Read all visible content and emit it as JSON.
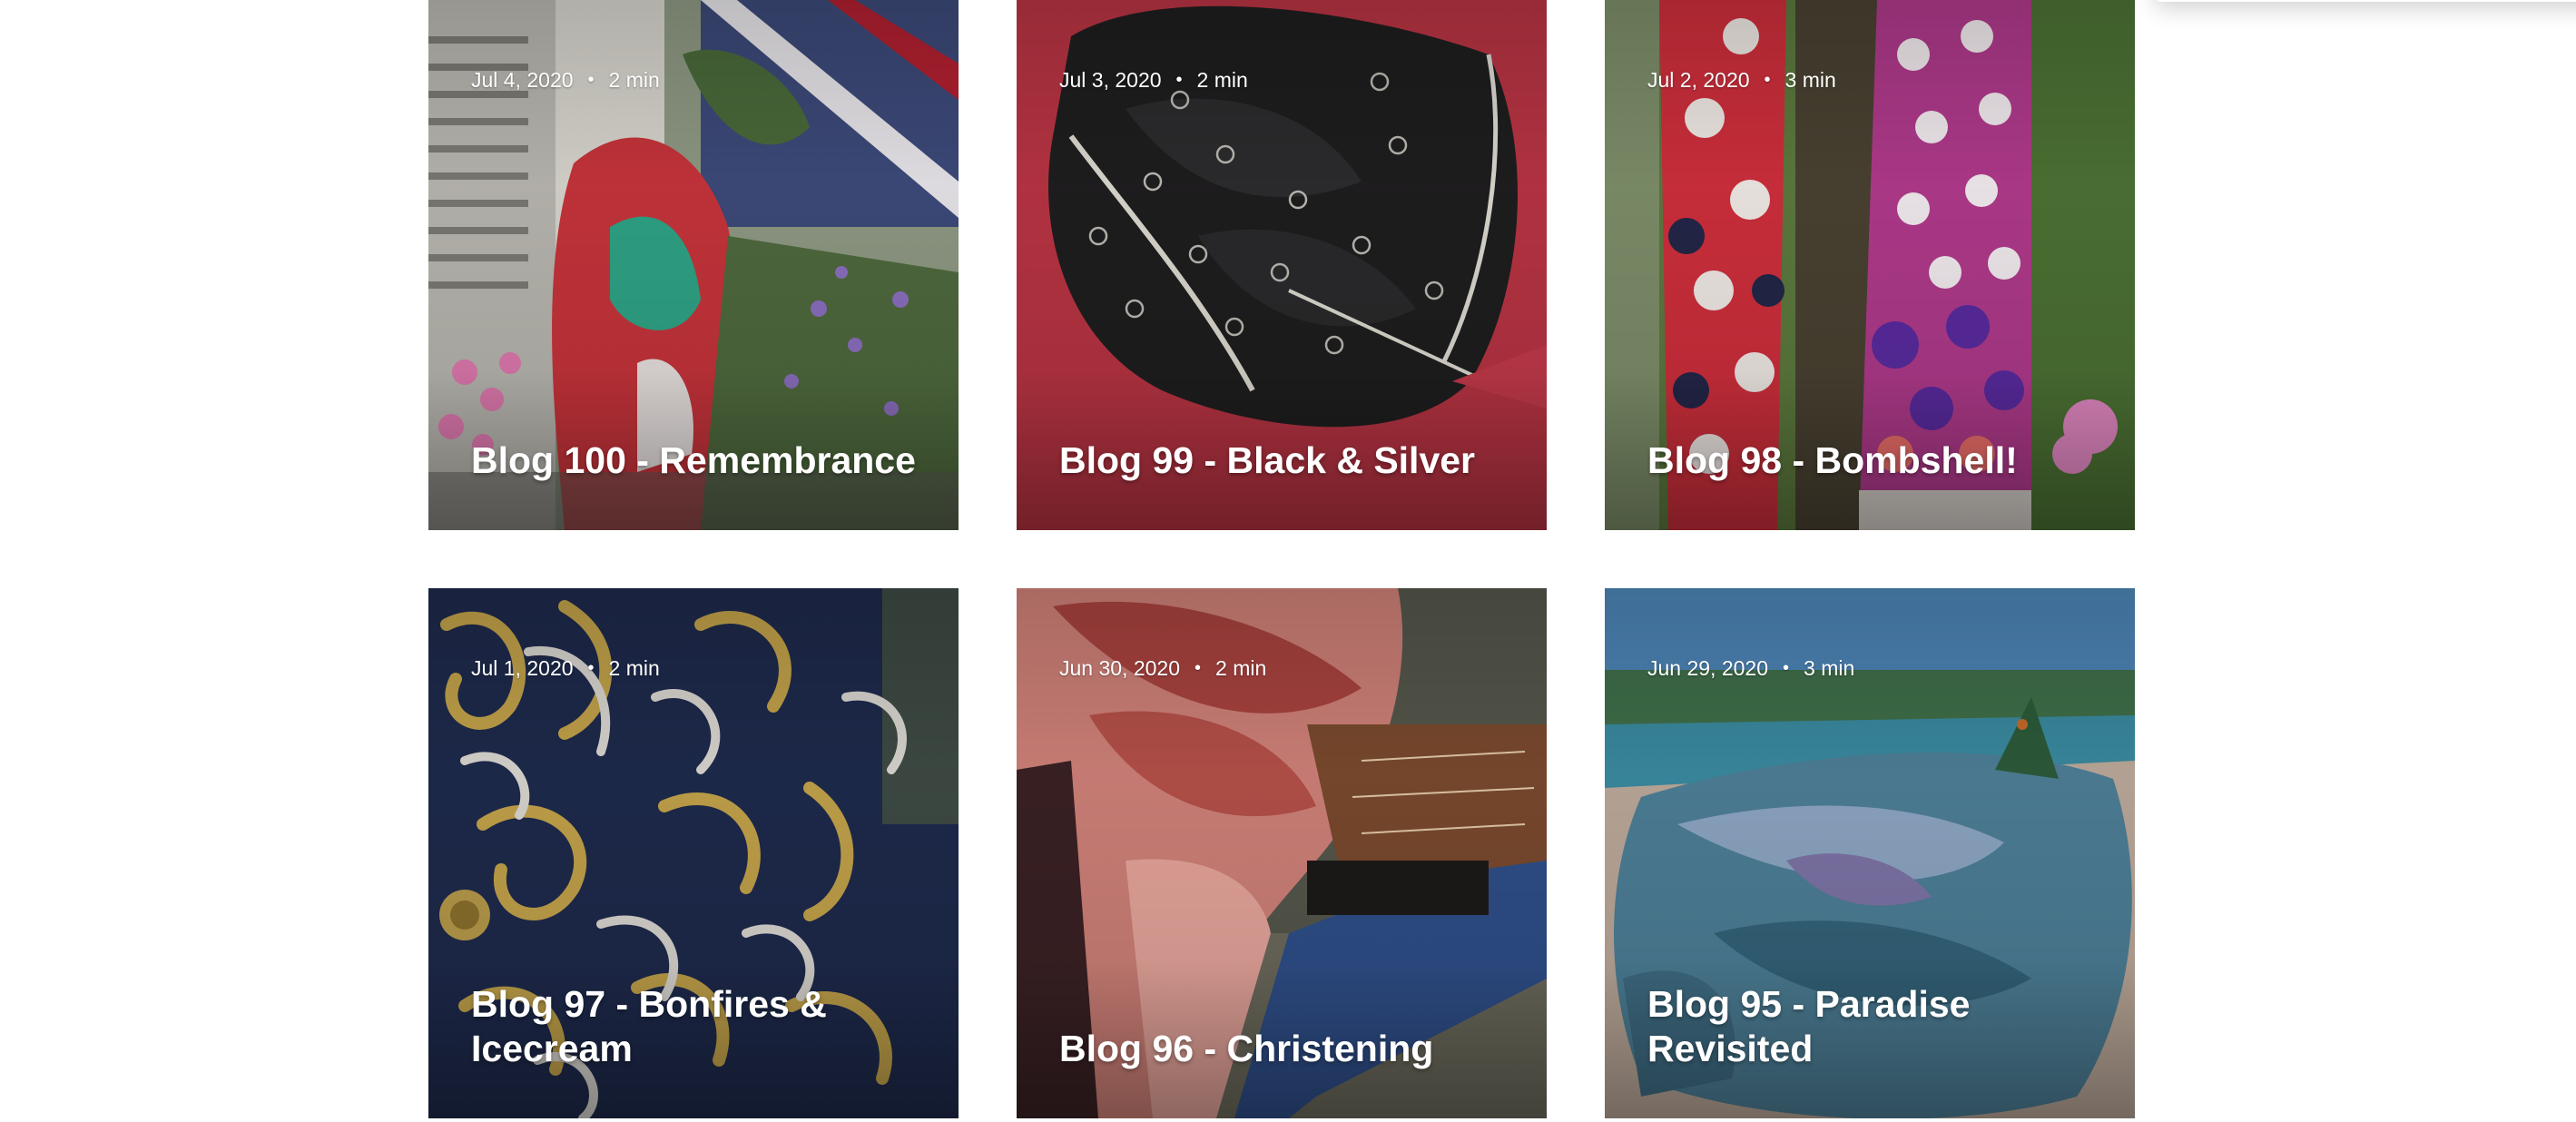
{
  "posts": [
    {
      "date": "Jul 4, 2020",
      "read_time": "2 min",
      "title": "Blog 100 - Remembrance"
    },
    {
      "date": "Jul 3, 2020",
      "read_time": "2 min",
      "title": "Blog 99 - Black & Silver"
    },
    {
      "date": "Jul 2, 2020",
      "read_time": "3 min",
      "title": "Blog 98 - Bombshell!"
    },
    {
      "date": "Jul 1, 2020",
      "read_time": "2 min",
      "title": "Blog 97 - Bonfires & Icecream"
    },
    {
      "date": "Jun 30, 2020",
      "read_time": "2 min",
      "title": "Blog 96 - Christening"
    },
    {
      "date": "Jun 29, 2020",
      "read_time": "3 min",
      "title": "Blog 95 - Paradise Revisited"
    }
  ],
  "separator": "•",
  "card_text_color": "#ffffff",
  "image_overlay": "rgba(0,0,0,0.2)"
}
